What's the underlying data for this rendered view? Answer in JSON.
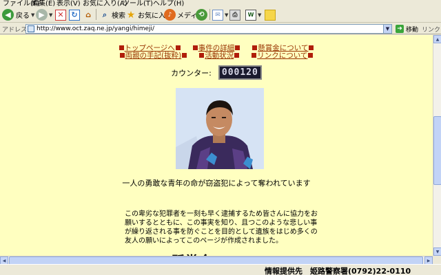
{
  "menu": [
    "ファイル(F)",
    "編集(E)",
    "表示(V)",
    "お気に入り(A)",
    "ツール(T)",
    "ヘルプ(H)"
  ],
  "toolbar": {
    "back_label": "戻る",
    "search_label": "検索",
    "favorites_label": "お気に入り",
    "media_label": "メディア"
  },
  "address": {
    "label": "アドレス(D)",
    "url": "http://www.oct.zaq.ne.jp/yangi/himeji/",
    "go_label": "移動",
    "links_label": "リンク"
  },
  "nav": {
    "row1": [
      "トップページへ",
      "事件の詳細",
      "懸賞金について"
    ],
    "row2": [
      "両親の手記(抜粋)",
      "活動状況",
      "リンクについて"
    ]
  },
  "counter": {
    "label": "カウンター:",
    "value": "000120"
  },
  "tagline": "一人の勇敢な青年の命が窃盗犯によって奪われています",
  "paragraph": "この卑劣な犯罪者を一刻も早く逮捕するため皆さんに協力をお願いするとともに、この事実を知り、且つこのような悲しい事が繰り返される事を防ぐことを目的として遺族をはじめ多くの友人の願いによってこのページが作成されました。",
  "heading_partial": "懸賞金",
  "status": "情報提供先　姫路警察署(0792)22-0110"
}
